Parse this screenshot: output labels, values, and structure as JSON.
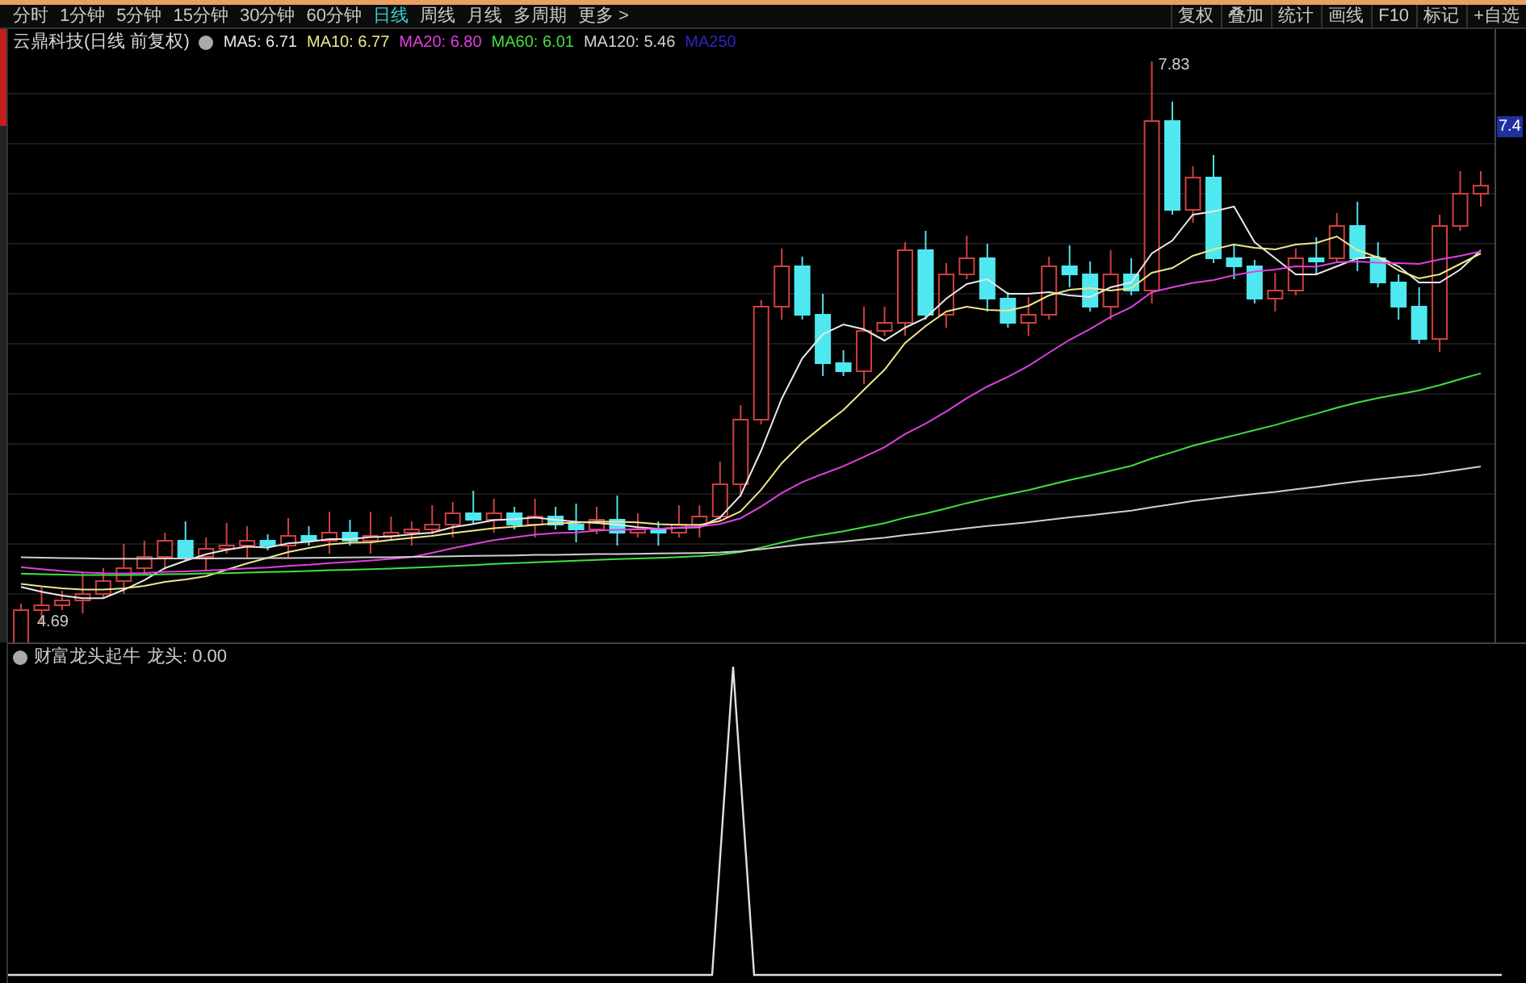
{
  "period_tabs": [
    {
      "label": "分时",
      "selected": false
    },
    {
      "label": "1分钟",
      "selected": false
    },
    {
      "label": "5分钟",
      "selected": false
    },
    {
      "label": "15分钟",
      "selected": false
    },
    {
      "label": "30分钟",
      "selected": false
    },
    {
      "label": "60分钟",
      "selected": false
    },
    {
      "label": "日线",
      "selected": true
    },
    {
      "label": "周线",
      "selected": false
    },
    {
      "label": "月线",
      "selected": false
    },
    {
      "label": "多周期",
      "selected": false
    },
    {
      "label": "更多 >",
      "selected": false
    }
  ],
  "toolbar_buttons": [
    "复权",
    "叠加",
    "统计",
    "画线",
    "F10",
    "标记",
    "+自选"
  ],
  "legend": {
    "title": "云鼎科技(日线 前复权)",
    "averages": [
      {
        "label": "MA5: 6.71",
        "color": "#e8e8e8"
      },
      {
        "label": "MA10: 6.77",
        "color": "#f0e68c"
      },
      {
        "label": "MA20: 6.80",
        "color": "#e040e0"
      },
      {
        "label": "MA60: 6.01",
        "color": "#40e040"
      },
      {
        "label": "MA120: 5.46",
        "color": "#d0d0d0"
      },
      {
        "label": "MA250",
        "color": "#2828c8"
      }
    ]
  },
  "price_chart": {
    "high_label": "7.83",
    "low_label": "4.69",
    "axis_label": "7.4"
  },
  "indicator": {
    "name": "财富龙头起牛",
    "reading": "龙头: 0.00"
  }
}
